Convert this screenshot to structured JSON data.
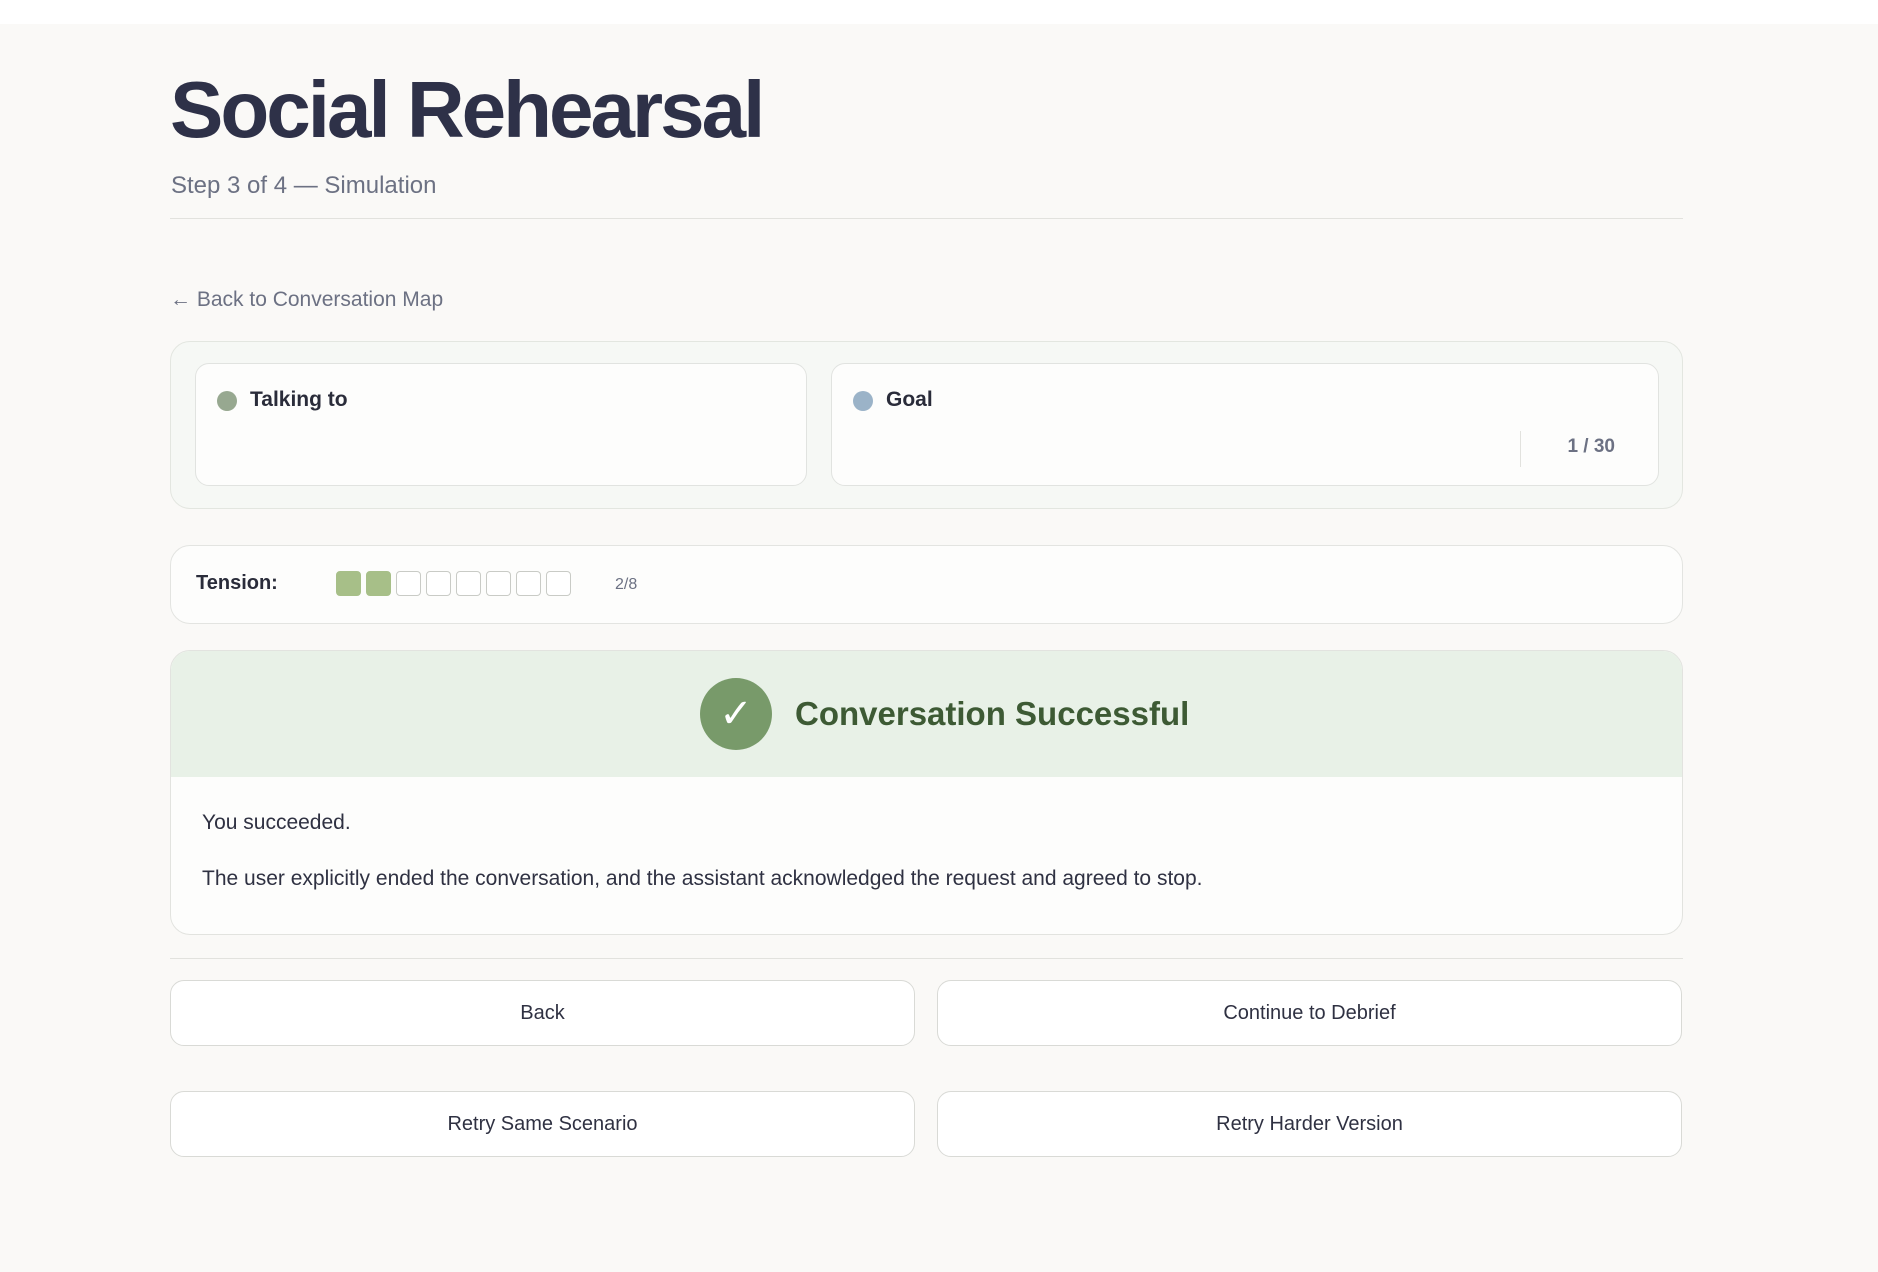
{
  "header": {
    "title": "Social Rehearsal",
    "subtitle": "Step 3 of 4 — Simulation"
  },
  "nav": {
    "back_link": "← Back to Conversation Map"
  },
  "info": {
    "talking_to_label": "Talking to",
    "goal_label": "Goal",
    "turn_counter": "1 / 30",
    "talking_to_dot_color": "#97a890",
    "goal_dot_color": "#9bb3c8"
  },
  "tension": {
    "label": "Tension:",
    "level": 2,
    "max": 8,
    "count_text": "2/8",
    "filled_color": "#a7bf88"
  },
  "result": {
    "icon": "checkmark-icon",
    "icon_glyph": "✓",
    "title": "Conversation Successful",
    "line1": "You succeeded.",
    "line2": "The user explicitly ended the conversation, and the assistant acknowledged the request and agreed to stop.",
    "accent_color": "#789a6a"
  },
  "actions": {
    "back": "Back",
    "continue": "Continue to Debrief",
    "retry_same": "Retry Same Scenario",
    "retry_harder": "Retry Harder Version"
  }
}
